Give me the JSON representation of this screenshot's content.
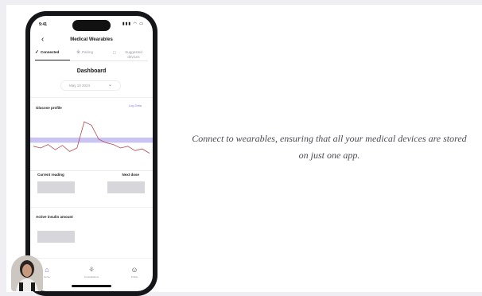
{
  "caption": {
    "line1": "Connect to wearables, ensuring that all your medical devices are stored",
    "line2": "on just one app."
  },
  "status_bar": {
    "time": "9:41",
    "icons": "▮▮▮ ◠ ▭"
  },
  "header": {
    "back_icon": "chevron-left-icon",
    "title": "Medical Wearables"
  },
  "tabs": [
    {
      "label": "Connected",
      "icon": "check-icon",
      "active": true
    },
    {
      "label": "Pairing",
      "icon": "bluetooth-icon",
      "active": false
    },
    {
      "label": "Suggested devices",
      "icon": "tag-icon",
      "active": false
    }
  ],
  "dashboard": {
    "heading": "Dashboard",
    "date": "May 10 2024"
  },
  "glucose": {
    "label": "Glucose profile",
    "link": "Log Data",
    "target_band_color": "#c9c4f2",
    "line_color": "#b24a52"
  },
  "chart_data": {
    "type": "line",
    "series": [
      {
        "values": [
          62,
          60,
          64,
          58,
          63,
          56,
          60,
          90,
          86,
          70,
          66,
          64,
          60,
          62,
          57,
          59,
          54
        ]
      }
    ],
    "target_range": [
      66,
      72
    ],
    "ylim": [
      40,
      100
    ]
  },
  "readings": {
    "current_label": "Current reading",
    "next_dose_label": "Next dose",
    "insulin_label": "Active insulin amount"
  },
  "bottom_nav": [
    {
      "label": "Home",
      "icon": "home-icon",
      "active": true,
      "color": "#7e6fd6"
    },
    {
      "label": "Consultations",
      "icon": "stethoscope-icon",
      "active": false,
      "color": "#8d8d95"
    },
    {
      "label": "Profile",
      "icon": "profile-icon",
      "active": false,
      "color": "#333333"
    }
  ]
}
